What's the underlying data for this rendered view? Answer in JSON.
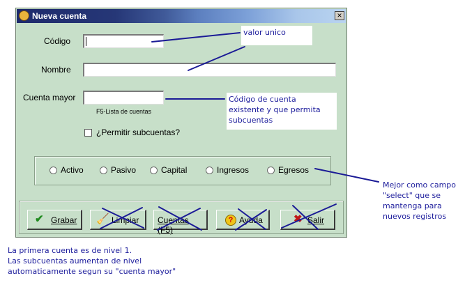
{
  "window": {
    "title": "Nueva cuenta",
    "close_glyph": "×",
    "title_icon": "app-icon"
  },
  "form": {
    "codigo_label": "Código",
    "codigo_value": "",
    "nombre_label": "Nombre",
    "nombre_value": "",
    "cuenta_mayor_label": "Cuenta mayor",
    "cuenta_mayor_value": "",
    "cuenta_mayor_hint": "F5-Lista de cuentas",
    "permitir_subcuentas_label": "¿Permitir subcuentas?",
    "permitir_subcuentas_checked": false
  },
  "account_types": [
    {
      "label": "Activo",
      "selected": false
    },
    {
      "label": "Pasivo",
      "selected": false
    },
    {
      "label": "Capital",
      "selected": false
    },
    {
      "label": "Ingresos",
      "selected": false
    },
    {
      "label": "Egresos",
      "selected": false
    }
  ],
  "buttons": {
    "grabar": {
      "label": "Grabar",
      "icon": "checkmark-icon",
      "crossed": false
    },
    "limpiar": {
      "label": "Limpiar",
      "icon": "broom-icon",
      "crossed": true
    },
    "cuentas": {
      "label": "Cuentas (F5)",
      "crossed": true
    },
    "ayuda": {
      "label": "Ayuda",
      "icon": "help-icon",
      "crossed": true
    },
    "salir": {
      "label": "Salir",
      "icon": "close-x-icon",
      "crossed": true
    }
  },
  "annotations": {
    "valor_unico": "valor unico",
    "cuenta_existente": [
      "Código de cuenta",
      "existente y que permita",
      "subcuentas"
    ],
    "campo_select": [
      "Mejor como campo",
      "\"select\" que se",
      "mantenga para",
      "nuevos registros"
    ],
    "nivel_note": [
      "La primera cuenta es de nivel 1.",
      "Las subcuentas aumentan de nivel",
      "automaticamente segun su \"cuenta mayor\""
    ]
  },
  "colors": {
    "window_bg": "#c7dfc9",
    "annotation_text": "#1d1d9c",
    "annotation_line": "#1b1b96",
    "grabar_check": "#1f8a1f",
    "salir_x": "#c01818"
  }
}
